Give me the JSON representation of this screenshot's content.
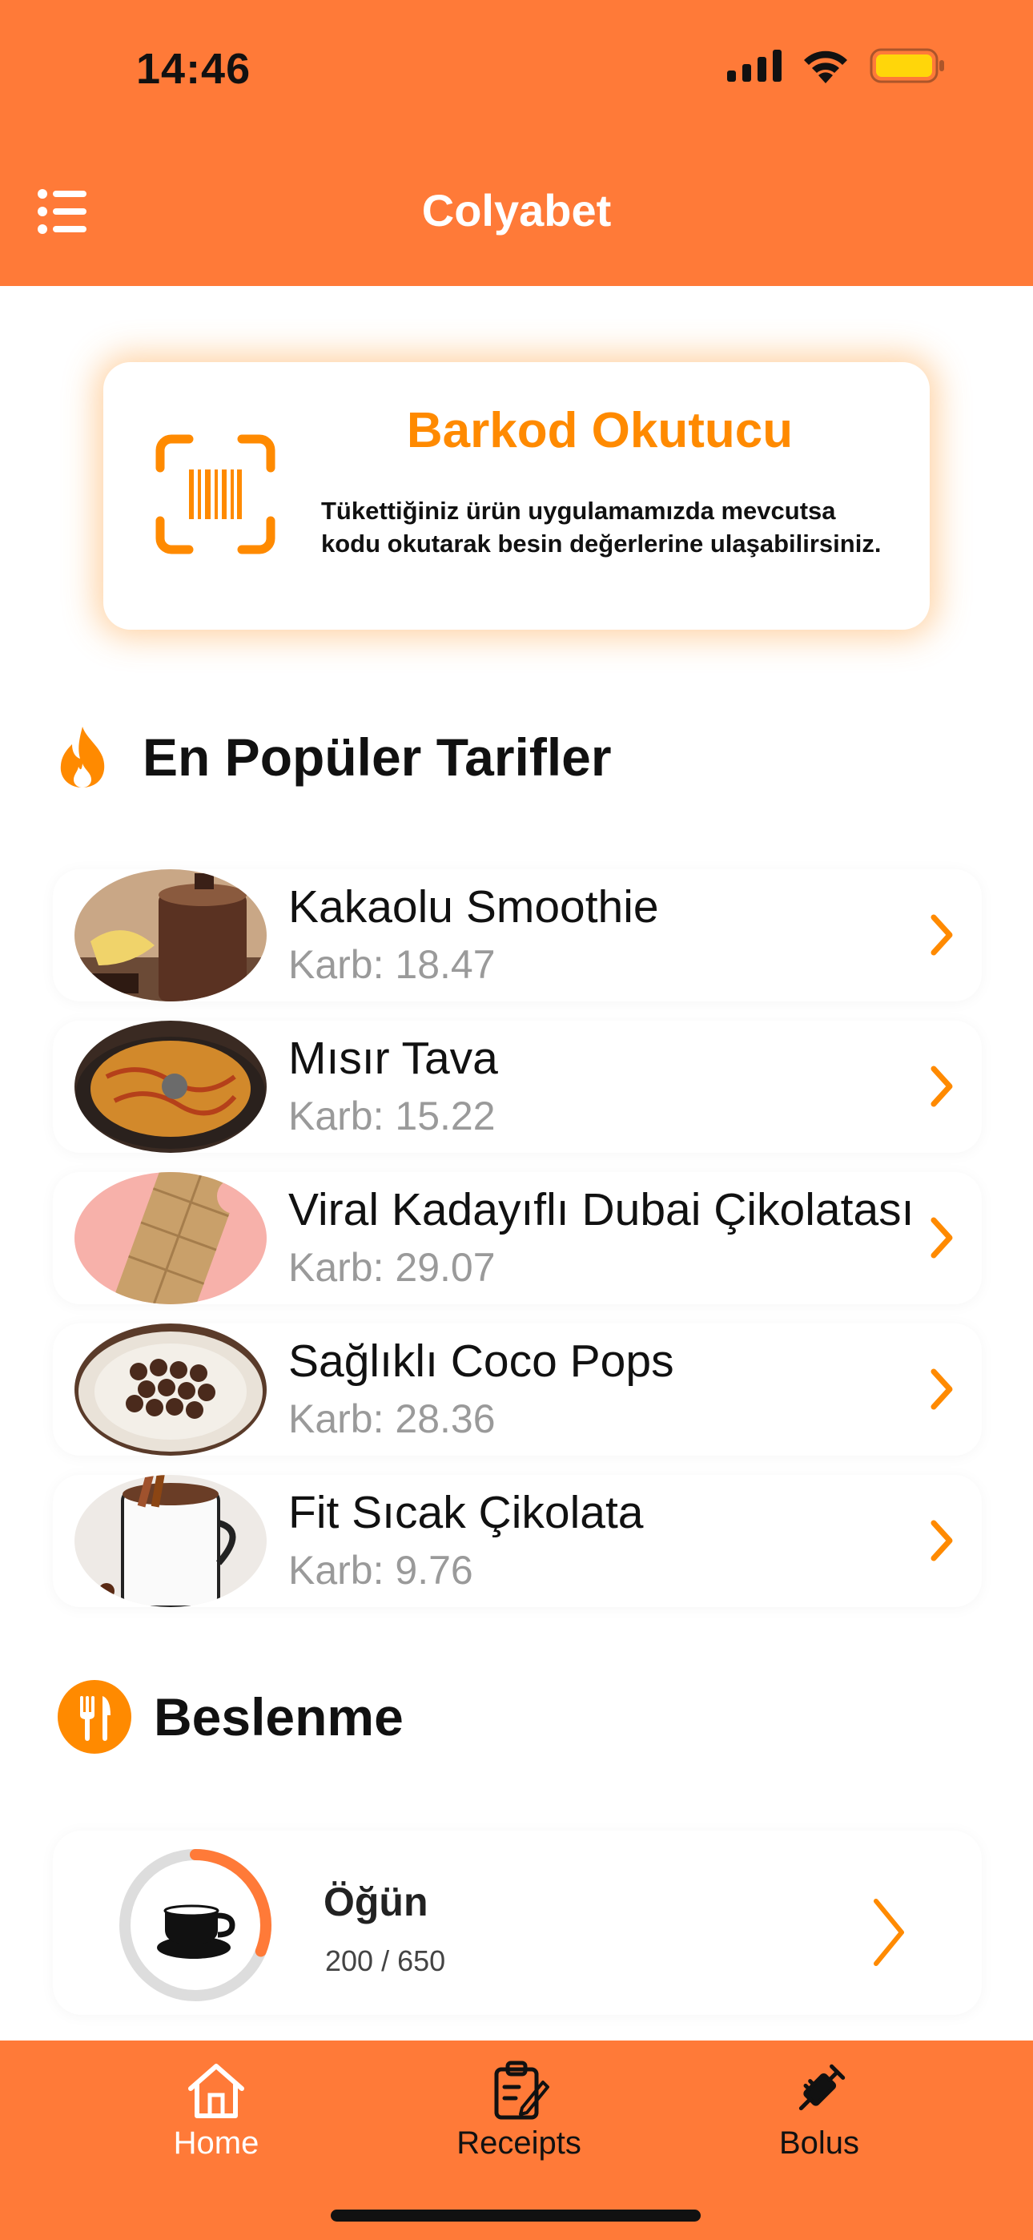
{
  "status_bar": {
    "time": "14:46"
  },
  "header": {
    "title": "Colyabet"
  },
  "barcode_card": {
    "title": "Barkod Okutucu",
    "description": "Tükettiğiniz ürün uygulamamızda mevcutsa kodu okutarak besin değerlerine ulaşabilirsiniz."
  },
  "popular": {
    "title": "En Popüler Tarifler",
    "items": [
      {
        "name": "Kakaolu Smoothie",
        "carb": "Karb: 18.47"
      },
      {
        "name": "Mısır Tava",
        "carb": "Karb: 15.22"
      },
      {
        "name": "Viral Kadayıflı Dubai Çikolatası",
        "carb": "Karb: 29.07"
      },
      {
        "name": "Sağlıklı Coco Pops",
        "carb": "Karb: 28.36"
      },
      {
        "name": "Fit Sıcak Çikolata",
        "carb": "Karb: 9.76"
      }
    ]
  },
  "nutrition": {
    "title": "Beslenme",
    "meal": {
      "title": "Öğün",
      "value": "200 / 650",
      "progress": 0.31
    }
  },
  "tabbar": {
    "items": [
      {
        "label": "Home",
        "icon": "house-icon",
        "active": true
      },
      {
        "label": "Receipts",
        "icon": "clipboard-edit-icon",
        "active": false
      },
      {
        "label": "Bolus",
        "icon": "syringe-icon",
        "active": false
      }
    ]
  },
  "colors": {
    "primary": "#FF7A38",
    "accent": "#FF8A00",
    "text": "#111111",
    "muted": "#9A9A9A"
  }
}
